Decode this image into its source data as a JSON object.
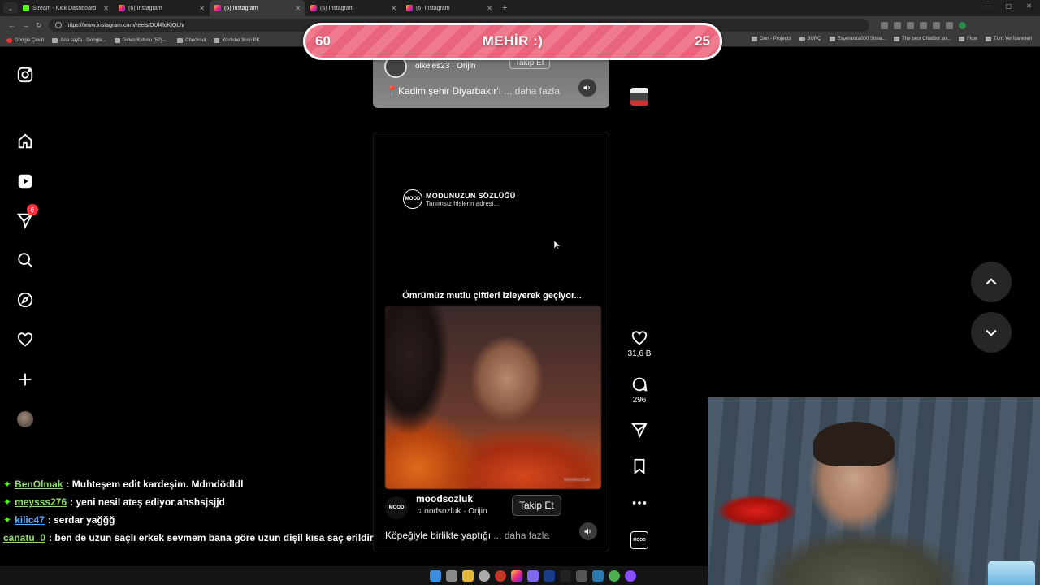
{
  "browser": {
    "tabs": [
      {
        "label": "Stream - Kick Dashboard",
        "kind": "kick",
        "active": false
      },
      {
        "label": "(6) Instagram",
        "kind": "ig",
        "active": false
      },
      {
        "label": "(6) Instagram",
        "kind": "ig",
        "active": true
      },
      {
        "label": "(6) Instagram",
        "kind": "ig",
        "active": false
      },
      {
        "label": "(6) Instagram",
        "kind": "ig",
        "active": false
      }
    ],
    "url": "https://www.instagram.com/reels/DUf4loKjQLh/",
    "bookmarks_left": [
      "Google Çeviri",
      "Ana sayfa - Google...",
      "Gelen Kutusu (52) -...",
      "Checkout",
      "Youtube 3ncü PK"
    ],
    "bookmarks_right": [
      "Gen - Projects",
      "BURÇ",
      "Esperanza000 Strea...",
      "The best ChatBot an...",
      "Flow",
      "Tüm Yer İşaretleri"
    ]
  },
  "timer": {
    "left": "60",
    "center": "MEHİR :)",
    "right": "25"
  },
  "nav": {
    "notification_badge": "6"
  },
  "prev_reel": {
    "username": "olkeles23 · Orijin",
    "follow": "Takip Et",
    "caption": "📍Kadim şehir Diyarbakır'ı",
    "more": "... daha fazla"
  },
  "reel": {
    "brand_logo": "MOOD",
    "brand_title": "MODUNUZUN SÖZLÜĞÜ",
    "brand_subtitle": "Tanımsız hislerin adresi...",
    "headline": "Ömrümüz mutlu çiftleri izleyerek geçiyor...",
    "watermark": "Moodsozluk",
    "username": "moodsozluk",
    "audio": "♫ oodsozluk · Orijin",
    "follow": "Takip Et",
    "caption": "Köpeğiyle birlikte yaptığı",
    "more": "... daha fazla"
  },
  "actions": {
    "likes": "31,6 B",
    "comments": "296"
  },
  "chat": [
    {
      "user": "BenOlmak",
      "message": ": Muhteşem edit kardeşim. Mdmdödldl",
      "color": "green"
    },
    {
      "user": "meysss276",
      "message": ": yeni nesil ateş ediyor ahshsjsjjd",
      "color": "green"
    },
    {
      "user": "kilic47",
      "message": ": serdar yağğğ",
      "color": "blue"
    },
    {
      "user": "canatu_0",
      "message": ": ben de uzun saçlı erkek sevmem bana göre uzun dişil kısa saç erildir",
      "color": "green"
    }
  ]
}
